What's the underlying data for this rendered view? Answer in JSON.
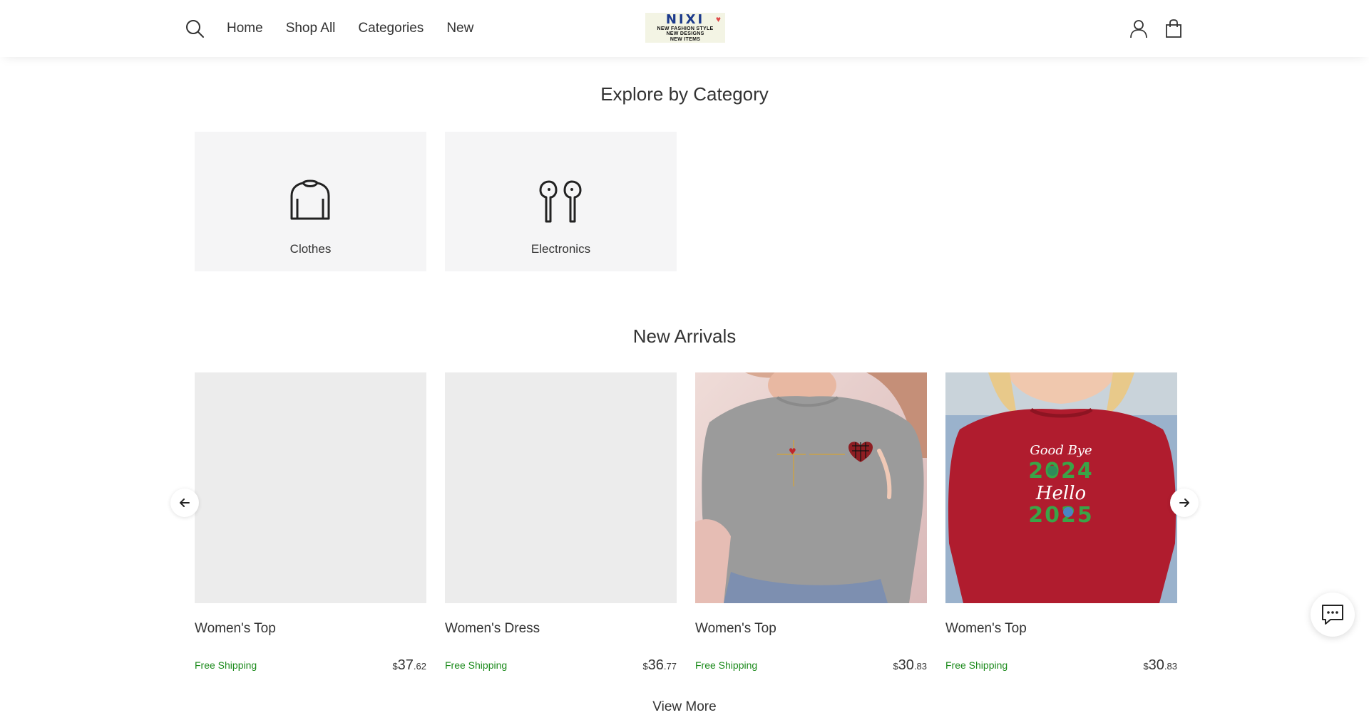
{
  "header": {
    "nav": [
      "Home",
      "Shop All",
      "Categories",
      "New"
    ],
    "logo": {
      "brand": "NIXI",
      "tagline": [
        "NEW FASHION STYLE",
        "NEW DESIGNS",
        "NEW ITEMS"
      ]
    }
  },
  "categories_section": {
    "title": "Explore by Category",
    "items": [
      {
        "label": "Clothes",
        "icon": "sweater-icon"
      },
      {
        "label": "Electronics",
        "icon": "earbuds-icon"
      }
    ]
  },
  "new_arrivals": {
    "title": "New Arrivals",
    "products": [
      {
        "name": "Women's Top",
        "shipping": "Free Shipping",
        "currency": "$",
        "price_whole": "37",
        "price_cents": ".62",
        "image": "placeholder"
      },
      {
        "name": "Women's Dress",
        "shipping": "Free Shipping",
        "currency": "$",
        "price_whole": "36",
        "price_cents": ".77",
        "image": "placeholder"
      },
      {
        "name": "Women's Top",
        "shipping": "Free Shipping",
        "currency": "$",
        "price_whole": "30",
        "price_cents": ".83",
        "image": "grey-sweatshirt"
      },
      {
        "name": "Women's Top",
        "shipping": "Free Shipping",
        "currency": "$",
        "price_whole": "30",
        "price_cents": ".83",
        "image": "red-sweatshirt"
      }
    ],
    "view_more": "View More"
  },
  "colors": {
    "free_shipping": "#1b8a1b",
    "tile_bg": "#f5f5f6",
    "placeholder_bg": "#ececec",
    "red_sweatshirt": "#b01c2e",
    "grey_sweatshirt": "#9a9a9a"
  }
}
